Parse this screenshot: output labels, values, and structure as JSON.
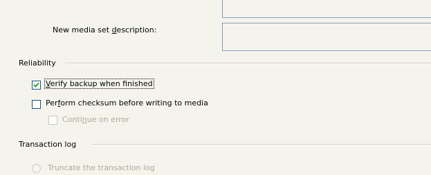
{
  "media_set": {
    "description_label_before": "New media set ",
    "description_label_accel": "d",
    "description_label_after": "escription:",
    "name_value": "",
    "description_value": ""
  },
  "reliability": {
    "group_label": "Reliability",
    "verify_label_accel": "V",
    "verify_label_rest": "erify backup when finished",
    "verify_checked": true,
    "checksum_label_before": "Per",
    "checksum_label_accel": "f",
    "checksum_label_after": "orm checksum before writing to media",
    "checksum_checked": false,
    "continue_label_before": "Conti",
    "continue_label_accel": "n",
    "continue_label_after": "ue on error",
    "continue_checked": false,
    "continue_enabled": false
  },
  "transaction_log": {
    "group_label": "Transaction log",
    "truncate_label": "Truncate the transaction log",
    "truncate_enabled": false
  },
  "colors": {
    "background": "#f5f4ec",
    "textbox_border": "#7f9db9",
    "checkbox_border": "#1c5180",
    "checkmark": "#21a121",
    "disabled_text": "#aca899"
  }
}
